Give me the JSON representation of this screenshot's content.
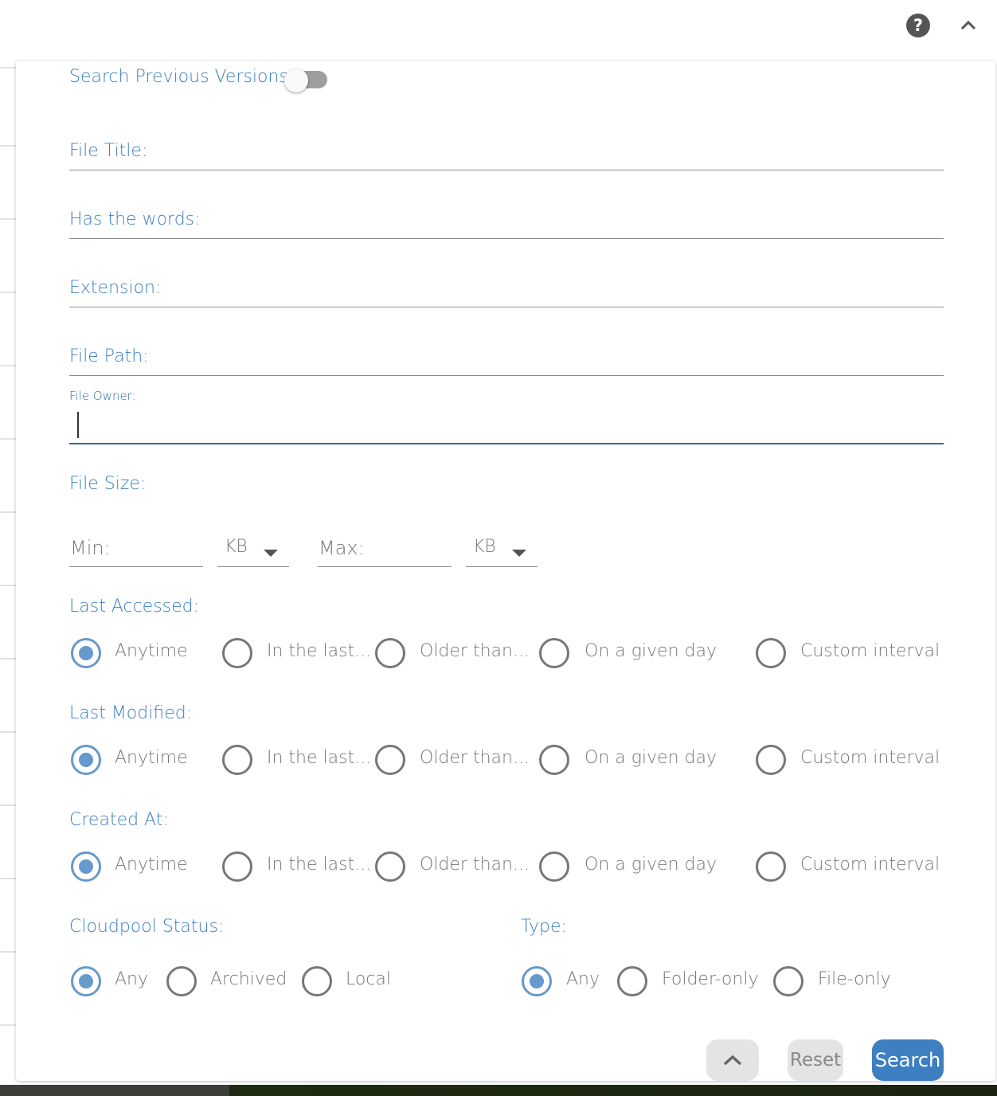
{
  "header": {
    "help_icon": "question-circle-icon",
    "collapse_icon": "chevron-up-icon"
  },
  "form": {
    "search_previous_versions": {
      "label": "Search Previous Versions:",
      "enabled": false
    },
    "file_title": {
      "label": "File Title:",
      "value": ""
    },
    "has_words": {
      "label": "Has the words:",
      "value": ""
    },
    "extension": {
      "label": "Extension:",
      "value": ""
    },
    "file_path": {
      "label": "File Path:",
      "value": ""
    },
    "file_owner": {
      "label": "File Owner:",
      "value": ""
    },
    "file_size": {
      "label": "File Size:",
      "min_placeholder": "Min:",
      "min_unit": "KB",
      "max_placeholder": "Max:",
      "max_unit": "KB"
    },
    "date_options": [
      "Anytime",
      "In the last...",
      "Older than...",
      "On a given day",
      "Custom interval"
    ],
    "last_accessed": {
      "label": "Last Accessed:",
      "selected": "Anytime"
    },
    "last_modified": {
      "label": "Last Modified:",
      "selected": "Anytime"
    },
    "created_at": {
      "label": "Created At:",
      "selected": "Anytime"
    },
    "cloudpool_status": {
      "label": "Cloudpool Status:",
      "options": [
        "Any",
        "Archived",
        "Local"
      ],
      "selected": "Any"
    },
    "type": {
      "label": "Type:",
      "options": [
        "Any",
        "Folder-only",
        "File-only"
      ],
      "selected": "Any"
    }
  },
  "buttons": {
    "collapse_icon": "chevron-up-icon",
    "reset": "Reset",
    "search": "Search"
  },
  "colors": {
    "accent": "#3d7fc1",
    "radio_selected": "#6699cc",
    "primary_button": "#3d7fc1"
  }
}
